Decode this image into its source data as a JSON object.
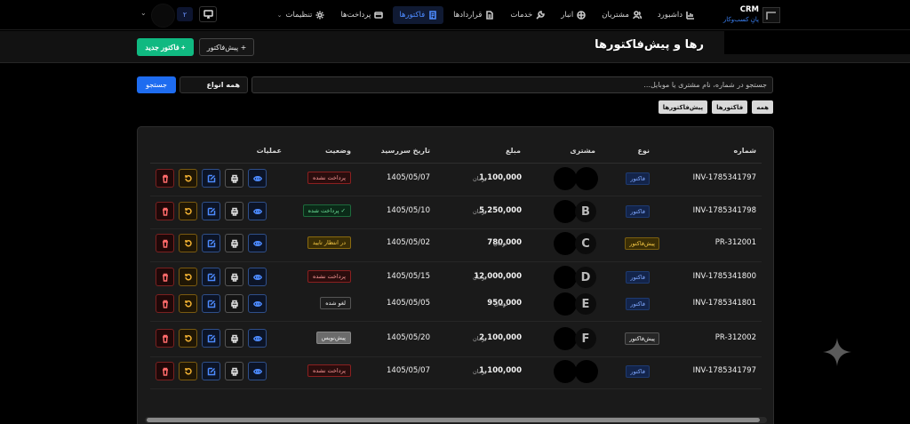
{
  "brand": {
    "title": "CRM",
    "subtitle": "پانِ کسب‌وکار"
  },
  "nav": {
    "dashboard": "داشبورد",
    "customers": "مشتریان",
    "inventory": "انبار",
    "services": "خدمات",
    "contracts": "قراردادها",
    "invoices": "فاکتورها",
    "payments": "پرداخت‌ها",
    "settings": "تنظیمات"
  },
  "header": {
    "lang_badge": "۲",
    "page_title": "رها و پیش‌فاکتورها",
    "new_invoice": "+ فاکتور جدید",
    "new_proforma": "+ پیش‌فاکتور"
  },
  "search": {
    "placeholder": "جستجو در شماره، نام مشتری یا موبایل...",
    "type_select": "همه انواع",
    "button": "جستجو"
  },
  "filters": [
    "همه",
    "فاکتورها",
    "پیش‌فاکتورها"
  ],
  "table": {
    "headers": {
      "number": "شماره",
      "type": "نوع",
      "customer": "مشتری",
      "amount": "مبلغ",
      "due_date": "تاریخ سررسید",
      "status": "وضعیت",
      "actions": "عملیات"
    },
    "currency_unit": "تومان",
    "rows": [
      {
        "number": "INV-1785341797",
        "type": "فاکتور",
        "customer_initial": "",
        "amount": "1,100,000",
        "due": "1405/05/07",
        "status": "پرداخت نشده"
      },
      {
        "number": "INV-1785341798",
        "type": "فاکتور",
        "customer_initial": "B",
        "amount": "5,250,000",
        "due": "1405/05/10",
        "status": "پرداخت شده ✓"
      },
      {
        "number": "PR-312001",
        "type": "پیش‌فاکتور",
        "customer_initial": "C",
        "amount": "780,000",
        "due": "1405/05/02",
        "status": "در انتظار تایید"
      },
      {
        "number": "INV-1785341800",
        "type": "فاکتور",
        "customer_initial": "D",
        "amount": "12,000,000",
        "due": "1405/05/15",
        "status": "پرداخت نشده"
      },
      {
        "number": "INV-1785341801",
        "type": "فاکتور",
        "customer_initial": "E",
        "amount": "950,000",
        "due": "1405/05/05",
        "status": "لغو شده"
      },
      {
        "number": "PR-312002",
        "type": "پیش‌فاکتور",
        "customer_initial": "F",
        "amount": "2,100,000",
        "due": "1405/05/20",
        "status": "پیش‌نویس"
      },
      {
        "number": "INV-1785341797",
        "type": "فاکتور",
        "customer_initial": "",
        "amount": "1,100,000",
        "due": "1405/05/07",
        "status": "پرداخت نشده"
      }
    ]
  }
}
